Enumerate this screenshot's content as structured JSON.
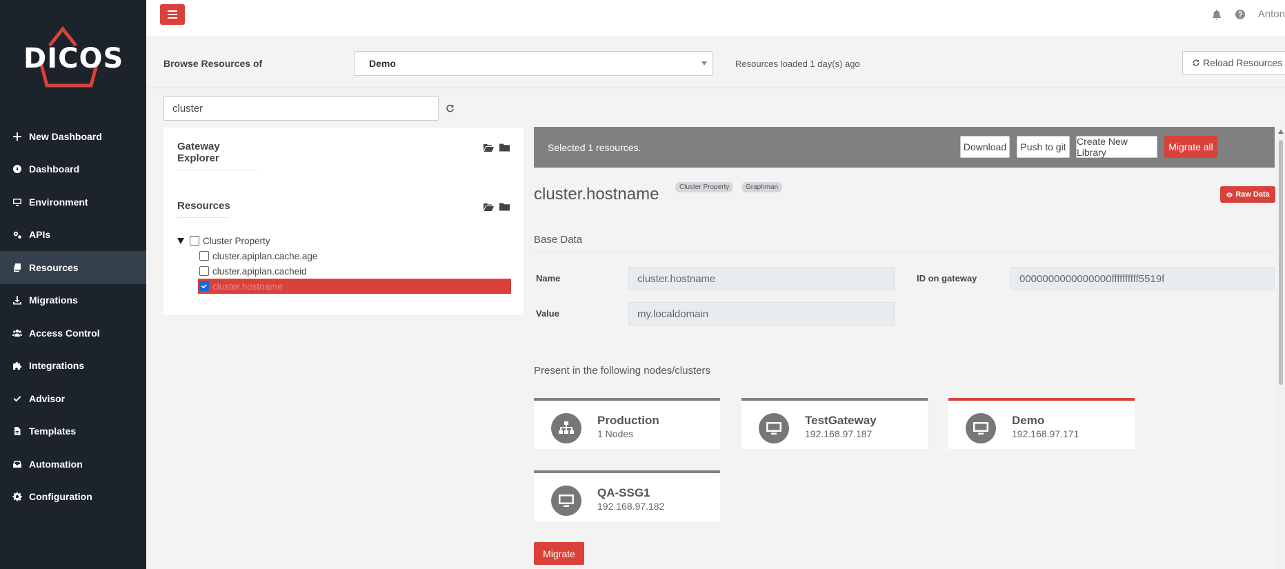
{
  "app": {
    "logo_text": "DICOS",
    "accent_color": "#d9413a",
    "sidebar_color": "#1c232b"
  },
  "sidebar": {
    "items": [
      {
        "label": "New Dashboard",
        "icon": "plus-icon"
      },
      {
        "label": "Dashboard",
        "icon": "dashboard-icon"
      },
      {
        "label": "Environment",
        "icon": "monitor-icon"
      },
      {
        "label": "APIs",
        "icon": "cogs-icon"
      },
      {
        "label": "Resources",
        "icon": "copy-icon",
        "active": true
      },
      {
        "label": "Migrations",
        "icon": "download-icon"
      },
      {
        "label": "Access Control",
        "icon": "users-icon"
      },
      {
        "label": "Integrations",
        "icon": "puzzle-icon"
      },
      {
        "label": "Advisor",
        "icon": "check-icon"
      },
      {
        "label": "Templates",
        "icon": "file-icon"
      },
      {
        "label": "Automation",
        "icon": "inbox-icon"
      },
      {
        "label": "Configuration",
        "icon": "gear-icon"
      }
    ]
  },
  "topbar": {
    "user_name": "Anton"
  },
  "browse": {
    "label": "Browse Resources of",
    "selected_environment": "Demo",
    "loaded_text": "Resources loaded 1 day(s) ago",
    "reload_label": "Reload Resources"
  },
  "search": {
    "value": "cluster"
  },
  "explorer": {
    "gateway_title": "Gateway Explorer",
    "resources_title": "Resources",
    "tree": {
      "root_label": "Cluster Property",
      "children": [
        {
          "label": "cluster.apiplan.cache.age",
          "checked": false
        },
        {
          "label": "cluster.apiplan.cacheid",
          "checked": false
        },
        {
          "label": "cluster.hostname",
          "checked": true,
          "selected": true
        }
      ]
    }
  },
  "selection_bar": {
    "text": "Selected 1 resources.",
    "download": "Download",
    "push_git": "Push to git",
    "create_library": "Create New Library",
    "migrate_all": "Migrate all"
  },
  "resource": {
    "title": "cluster.hostname",
    "tags": [
      "Cluster Property",
      "Graphman"
    ],
    "raw_data_label": "Raw Data",
    "base_data_title": "Base Data",
    "fields": {
      "name_label": "Name",
      "name_value": "cluster.hostname",
      "id_label": "ID on gateway",
      "id_value": "0000000000000000ffffffffff5519f",
      "value_label": "Value",
      "value_value": "my.localdomain"
    },
    "nodes_title": "Present in the following nodes/clusters",
    "nodes": [
      {
        "name": "Production",
        "sub": "1 Nodes",
        "icon": "sitemap-icon",
        "active": false
      },
      {
        "name": "TestGateway",
        "sub": "192.168.97.187",
        "icon": "monitor-icon",
        "active": false
      },
      {
        "name": "Demo",
        "sub": "192.168.97.171",
        "icon": "monitor-icon",
        "active": true
      },
      {
        "name": "QA-SSG1",
        "sub": "192.168.97.182",
        "icon": "monitor-icon",
        "active": false
      }
    ],
    "migrate_label": "Migrate"
  }
}
